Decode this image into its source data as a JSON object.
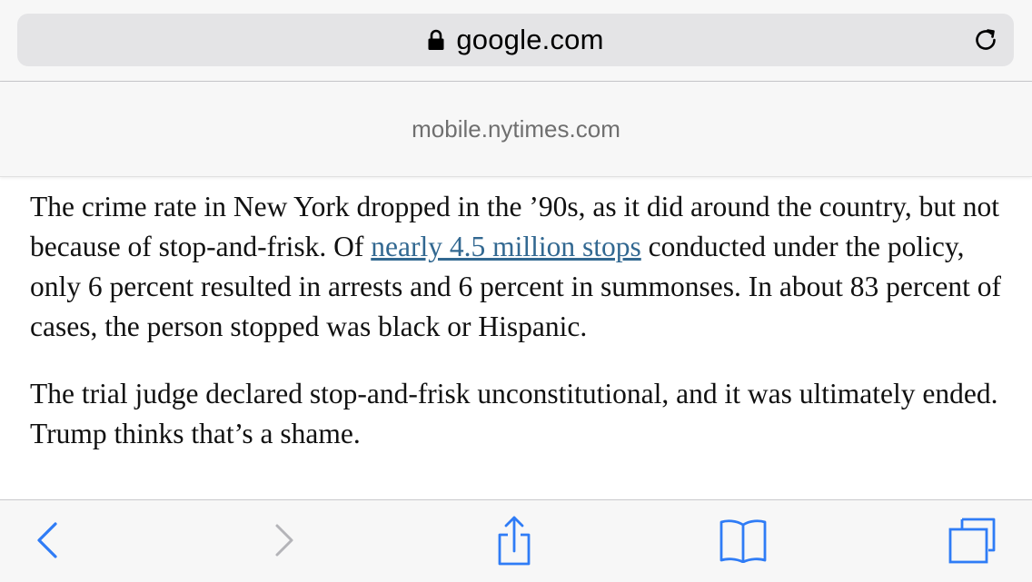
{
  "address_bar": {
    "url": "google.com",
    "icons": {
      "lock": "lock-icon",
      "reload": "reload-icon"
    }
  },
  "site_banner": {
    "text": "mobile.nytimes.com"
  },
  "article": {
    "paragraphs": [
      {
        "before_link": "The crime rate in New York dropped in the ’90s, as it did around the country, but not because of stop-and-frisk. Of ",
        "link": "nearly 4.5 million stops",
        "after_link": " conducted under the policy, only 6 percent resulted in arrests and 6 percent in summonses. In about 83 percent of cases, the person stopped was black or Hispanic."
      },
      {
        "text": "The trial judge declared stop-and-frisk unconstitutional, and it was ultimately ended. Trump thinks that’s a shame."
      }
    ]
  },
  "toolbar": {
    "items": [
      "back-icon",
      "forward-icon",
      "share-icon",
      "bookmarks-icon",
      "tabs-icon"
    ]
  },
  "colors": {
    "accent": "#2f7cf6",
    "disabled": "#b4b4b8",
    "link": "#326891",
    "bar_background": "#f7f7f7",
    "url_field": "#e4e4e6"
  }
}
